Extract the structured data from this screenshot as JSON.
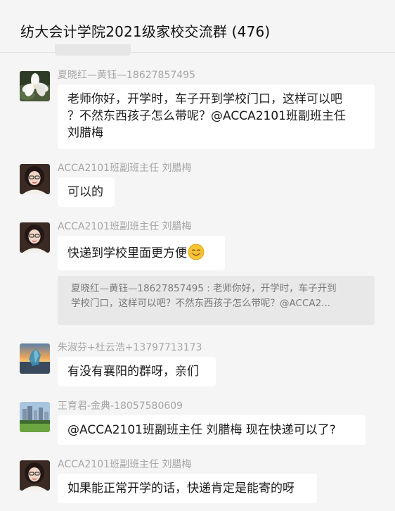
{
  "header": {
    "title": "纺大会计学院2021级家校交流群 (476)"
  },
  "messages": [
    {
      "sender": "夏晓红—黄钰—18627857495",
      "lines": [
        "老师你好，开学时，车子开到学校门口，这样可以吧",
        "？不然东西孩子怎么带呢？@ACCA2101班副班主任",
        "刘腊梅"
      ],
      "avatar": "gardenia-flower-avatar"
    },
    {
      "sender": "ACCA2101班副班主任 刘腊梅",
      "lines": [
        "可以的"
      ],
      "avatar": "woman-glasses-avatar"
    },
    {
      "sender": "ACCA2101班副班主任 刘腊梅",
      "lines": [
        "快递到学校里面更方便"
      ],
      "emoji": "smiling-face-emoji",
      "avatar": "woman-glasses-avatar",
      "quote": {
        "line1": "夏晓红—黄钰—18627857495 : 老师你好，开学时，车子开到",
        "line2": "学校门口，这样可以吧？不然东西孩子怎么带呢？@ACCA2..."
      }
    },
    {
      "sender": "朱淑芬+杜云浩+13797713173",
      "lines": [
        "有没有襄阳的群呀，亲们"
      ],
      "avatar": "sunset-crystal-avatar"
    },
    {
      "sender": "王育君-金典-18057580609",
      "lines": [
        "@ACCA2101班副班主任 刘腊梅 现在快递可以了?"
      ],
      "avatar": "city-park-avatar"
    },
    {
      "sender": "ACCA2101班副班主任 刘腊梅",
      "lines": [
        "如果能正常开学的话，快递肯定是能寄的呀"
      ],
      "avatar": "woman-glasses-avatar"
    }
  ],
  "colors": {
    "background": "#f5f5f5",
    "bubble": "#ffffff",
    "sender_text": "#a6a6a6",
    "quote_bg": "#e8e8e8"
  }
}
